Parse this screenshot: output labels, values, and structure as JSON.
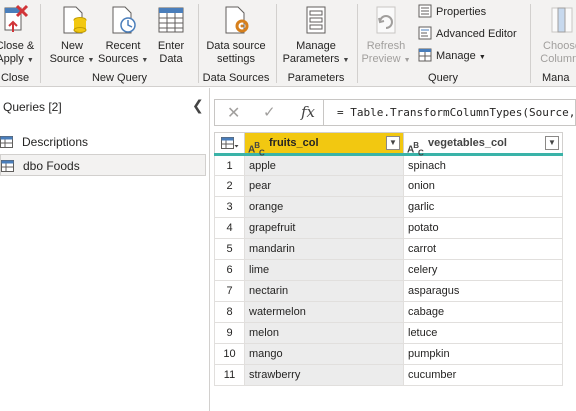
{
  "ribbon": {
    "close": {
      "label1": "Close &",
      "label2": "Apply",
      "group": "Close"
    },
    "new_query": {
      "group": "New Query",
      "new_source": {
        "label1": "New",
        "label2": "Source"
      },
      "recent_sources": {
        "label1": "Recent",
        "label2": "Sources"
      },
      "enter_data": {
        "label1": "Enter",
        "label2": "Data"
      }
    },
    "data_sources": {
      "group": "Data Sources",
      "settings": {
        "label1": "Data source",
        "label2": "settings"
      }
    },
    "parameters": {
      "group": "Parameters",
      "manage": {
        "label1": "Manage",
        "label2": "Parameters"
      }
    },
    "query": {
      "group": "Query",
      "refresh": {
        "label1": "Refresh",
        "label2": "Preview"
      },
      "properties": "Properties",
      "advanced_editor": "Advanced Editor",
      "manage": "Manage"
    },
    "choose_columns": {
      "label1": "Choose",
      "label2": "Columns",
      "group": "Mana"
    }
  },
  "queries": {
    "title": "Queries [2]",
    "items": [
      {
        "label": "Descriptions"
      },
      {
        "label": "dbo Foods"
      }
    ]
  },
  "formula": {
    "fx": "fx",
    "text": "= Table.TransformColumnTypes(Source,{"
  },
  "table": {
    "type_icon": "ABC",
    "columns": [
      "fruits_col",
      "vegetables_col"
    ],
    "rows": [
      [
        "1",
        "apple",
        "spinach"
      ],
      [
        "2",
        "pear",
        "onion"
      ],
      [
        "3",
        "orange",
        "garlic"
      ],
      [
        "4",
        "grapefruit",
        "potato"
      ],
      [
        "5",
        "mandarin",
        "carrot"
      ],
      [
        "6",
        "lime",
        "celery"
      ],
      [
        "7",
        "nectarin",
        "asparagus"
      ],
      [
        "8",
        "watermelon",
        "cabage"
      ],
      [
        "9",
        "melon",
        "letuce"
      ],
      [
        "10",
        "mango",
        "pumpkin"
      ],
      [
        "11",
        "strawberry",
        "cucumber"
      ]
    ]
  },
  "colors": {
    "accent_header": "#f2c811",
    "quality_bar": "#3ab3a8",
    "ribbon_bg": "#f3f2f1"
  }
}
